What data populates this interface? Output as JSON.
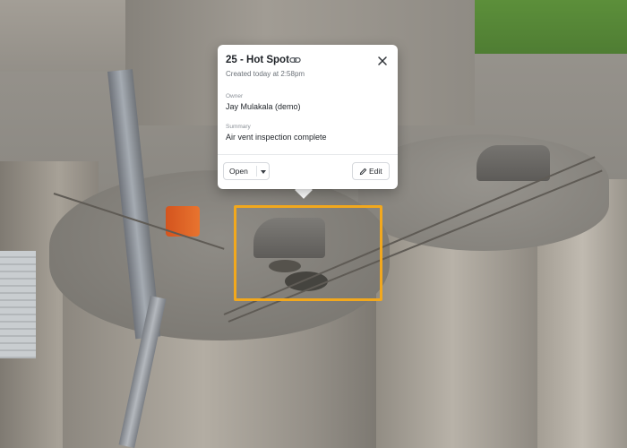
{
  "popover": {
    "title": "25 - Hot Spot",
    "created": "Created today at 2:58pm",
    "owner_label": "Owner",
    "owner_value": "Jay Mulakala (demo)",
    "summary_label": "Summary",
    "summary_value": "Air vent inspection complete",
    "status_value": "Open",
    "edit_label": "Edit",
    "icons": {
      "link": "link-icon",
      "close": "close-icon",
      "caret": "chevron-down-icon",
      "edit": "pencil-icon"
    }
  },
  "hotspot": {
    "highlight_color": "#f2a81d"
  }
}
